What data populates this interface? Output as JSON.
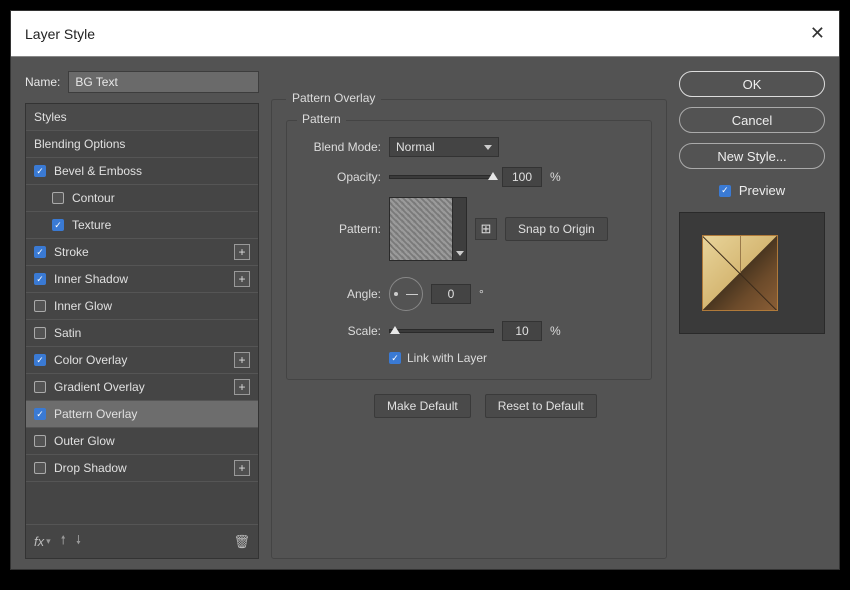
{
  "dialog": {
    "title": "Layer Style"
  },
  "name": {
    "label": "Name:",
    "value": "BG Text"
  },
  "styles_header": "Styles",
  "styles": [
    {
      "label": "Blending Options",
      "checked": null,
      "indent": false,
      "plus": false
    },
    {
      "label": "Bevel & Emboss",
      "checked": true,
      "indent": false,
      "plus": false
    },
    {
      "label": "Contour",
      "checked": false,
      "indent": true,
      "plus": false
    },
    {
      "label": "Texture",
      "checked": true,
      "indent": true,
      "plus": false
    },
    {
      "label": "Stroke",
      "checked": true,
      "indent": false,
      "plus": true
    },
    {
      "label": "Inner Shadow",
      "checked": true,
      "indent": false,
      "plus": true
    },
    {
      "label": "Inner Glow",
      "checked": false,
      "indent": false,
      "plus": false
    },
    {
      "label": "Satin",
      "checked": false,
      "indent": false,
      "plus": false
    },
    {
      "label": "Color Overlay",
      "checked": true,
      "indent": false,
      "plus": true
    },
    {
      "label": "Gradient Overlay",
      "checked": false,
      "indent": false,
      "plus": true
    },
    {
      "label": "Pattern Overlay",
      "checked": true,
      "indent": false,
      "plus": false,
      "selected": true
    },
    {
      "label": "Outer Glow",
      "checked": false,
      "indent": false,
      "plus": false
    },
    {
      "label": "Drop Shadow",
      "checked": false,
      "indent": false,
      "plus": true
    }
  ],
  "footer": {
    "fx": "fx",
    "up": "▲",
    "down": "▼",
    "trash": "🗑"
  },
  "panel": {
    "title": "Pattern Overlay",
    "group": "Pattern",
    "blend_mode_label": "Blend Mode:",
    "blend_mode_value": "Normal",
    "opacity_label": "Opacity:",
    "opacity_value": "100",
    "opacity_unit": "%",
    "pattern_label": "Pattern:",
    "new_preset": "⊕",
    "snap_btn": "Snap to Origin",
    "angle_label": "Angle:",
    "angle_value": "0",
    "angle_unit": "°",
    "scale_label": "Scale:",
    "scale_value": "10",
    "scale_unit": "%",
    "link_label": "Link with Layer",
    "link_checked": true,
    "make_default": "Make Default",
    "reset_default": "Reset to Default"
  },
  "buttons": {
    "ok": "OK",
    "cancel": "Cancel",
    "new_style": "New Style...",
    "preview": "Preview",
    "preview_checked": true
  }
}
